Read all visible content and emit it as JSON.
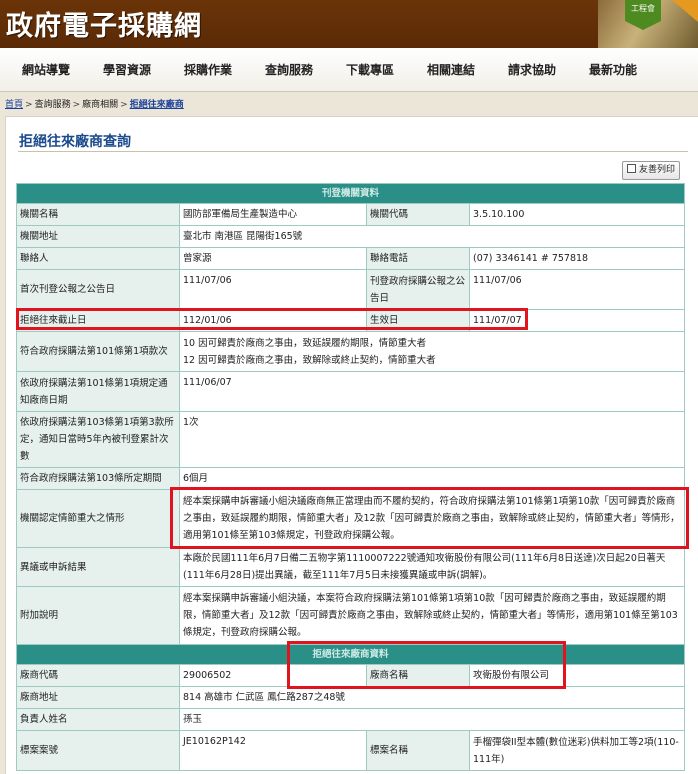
{
  "header": {
    "site_title": "政府電子採購網",
    "badge_text": "工程會"
  },
  "nav": {
    "items": [
      {
        "label": "網站導覽",
        "name": "nav-site-guide"
      },
      {
        "label": "學習資源",
        "name": "nav-learning"
      },
      {
        "label": "採購作業",
        "name": "nav-procurement"
      },
      {
        "label": "查詢服務",
        "name": "nav-query"
      },
      {
        "label": "下載專區",
        "name": "nav-download"
      },
      {
        "label": "相關連結",
        "name": "nav-links"
      },
      {
        "label": "請求協助",
        "name": "nav-help"
      },
      {
        "label": "最新功能",
        "name": "nav-new"
      }
    ]
  },
  "breadcrumb": {
    "home": "首頁",
    "sep": ">",
    "query": "查詢服務",
    "vendor": "廠商相關",
    "current": "拒絕往來廠商"
  },
  "page": {
    "title": "拒絕往來廠商查詢",
    "print_label": "友善列印"
  },
  "publisher": {
    "section_title": "刊登機關資料",
    "agency_name_label": "機關名稱",
    "agency_name": "國防部軍備局生產製造中心",
    "agency_code_label": "機關代碼",
    "agency_code": "3.5.10.100",
    "address_label": "機關地址",
    "address": "臺北市 南港區 昆陽街165號",
    "contact_label": "聯絡人",
    "contact": "曾家源",
    "phone_label": "聯絡電話",
    "phone": "(07) 3346141 # 757818",
    "first_notice_label": "首次刊登公報之公告日",
    "first_notice": "111/07/06",
    "gazette_label": "刊登政府採購公報之公告日",
    "gazette_date": "111/07/06",
    "deadline_label": "拒絕往來截止日",
    "deadline": "112/01/06",
    "effective_label": "生效日",
    "effective": "111/07/07",
    "clause_label": "符合政府採購法第101條第1項款次",
    "clause_lines": [
      "10 因可歸責於廠商之事由，致延誤履約期限，情節重大者",
      "12 因可歸責於廠商之事由，致解除或終止契約，情節重大者"
    ],
    "notify_label": "依政府採購法第101條第1項規定通知廠商日期",
    "notify_date": "111/06/07",
    "count_label": "依政府採購法第103條第1項第3款所定，通知日當時5年內被刊登累計次數",
    "count": "1次",
    "period_label": "符合政府採購法第103條所定期間",
    "period": "6個月",
    "severity_label": "機關認定情節重大之情形",
    "severity_text": "經本案採購申訴審議小組決議廠商無正當理由而不履約契約，符合政府採購法第101條第1項第10款「因可歸責於廠商之事由，致延誤履約期限，情節重大者」及12款「因可歸責於廠商之事由，致解除或終止契約，情節重大者」等情形，適用第101條至第103條規定，刊登政府採購公報。",
    "appeal_label": "異議或申訴結果",
    "appeal_text": "本廠於民國111年6月7日備二五物字第1110007222號通知攻衛股份有限公司(111年6月8日送達)次日起20日著天(111年6月28日)提出異議，截至111年7月5日未接獲異議或申訴(調解)。",
    "note_label": "附加說明",
    "note_text": "經本案採購申訴審議小組決議，本案符合政府採購法第101條第1項第10款「因可歸責於廠商之事由，致延誤履約期限，情節重大者」及12款「因可歸責於廠商之事由，致解除或終止契約，情節重大者」等情形，適用第101條至第103條規定，刊登政府採購公報。"
  },
  "vendor": {
    "section_title": "拒絕往來廠商資料",
    "code_label": "廠商代碼",
    "code": "29006502",
    "name_label": "廠商名稱",
    "name": "攻衛股份有限公司",
    "address_label": "廠商地址",
    "address": "814 高雄市 仁武區 鳳仁路287之48號",
    "owner_label": "負責人姓名",
    "owner": "孫玉",
    "case_no_label": "標案案號",
    "case_no": "JE10162P142",
    "case_name_label": "標案名稱",
    "case_name": "手榴彈袋II型本體(數位迷彩)供料加工等2項(110-111年)"
  },
  "colors": {
    "header_brown": "#5a2a06",
    "section_teal": "#2a8f86",
    "label_bg": "#e6f1ee",
    "highlight_red": "#e0141e",
    "title_blue": "#1a4a8c"
  }
}
